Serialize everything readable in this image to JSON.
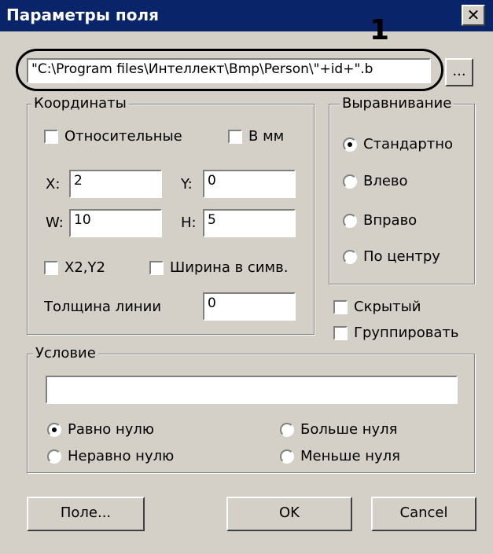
{
  "window": {
    "title": "Параметры поля",
    "close_glyph": "✕",
    "annotation_number": "1"
  },
  "path": {
    "value": "\"C:\\Program files\\Интеллект\\Bmp\\Person\\\"+id+\".b",
    "browse_label": "..."
  },
  "coords": {
    "group_label": "Координаты",
    "relative": {
      "label": "Относительные",
      "checked": false
    },
    "in_mm": {
      "label": "В мм",
      "checked": false
    },
    "x": {
      "label": "X:",
      "value": "2"
    },
    "y": {
      "label": "Y:",
      "value": "0"
    },
    "w": {
      "label": "W:",
      "value": "10"
    },
    "h": {
      "label": "H:",
      "value": "5"
    },
    "x2y2": {
      "label": "X2,Y2",
      "checked": false
    },
    "width_chars": {
      "label": "Ширина в симв.",
      "checked": false
    },
    "line_thickness": {
      "label": "Толщина линии",
      "value": "0"
    }
  },
  "align": {
    "group_label": "Выравнивание",
    "options": [
      {
        "label": "Стандартно",
        "selected": true
      },
      {
        "label": "Влево",
        "selected": false
      },
      {
        "label": "Вправо",
        "selected": false
      },
      {
        "label": "По центру",
        "selected": false
      }
    ]
  },
  "hidden": {
    "label": "Скрытый",
    "checked": false
  },
  "group": {
    "label": "Группировать",
    "checked": false
  },
  "condition": {
    "group_label": "Условие",
    "value": "",
    "options": [
      {
        "label": "Равно нулю",
        "selected": true
      },
      {
        "label": "Больше нуля",
        "selected": false
      },
      {
        "label": "Неравно нулю",
        "selected": false
      },
      {
        "label": "Меньше нуля",
        "selected": false
      }
    ]
  },
  "buttons": {
    "field": "Поле...",
    "ok": "OK",
    "cancel": "Cancel"
  }
}
